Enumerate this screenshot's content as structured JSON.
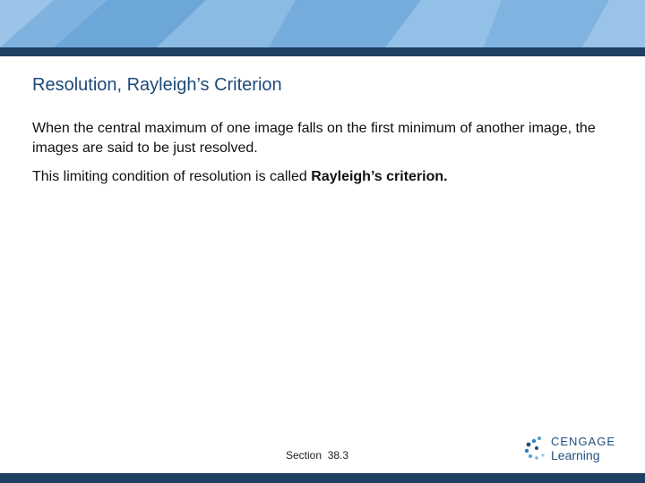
{
  "slide": {
    "title": "Resolution, Rayleigh’s Criterion",
    "paragraph1": "When the central maximum of one image falls on the first minimum of another image, the images are said to be just resolved.",
    "paragraph2_prefix": "This limiting condition of resolution is called ",
    "paragraph2_bold": "Rayleigh’s criterion."
  },
  "footer": {
    "section": "Section  38.3",
    "logo_line1": "CENGAGE",
    "logo_line2": "Learning"
  },
  "colors": {
    "header_light": "#7fb2df",
    "header_dark": "#1f3f63",
    "title": "#1d4a78"
  }
}
